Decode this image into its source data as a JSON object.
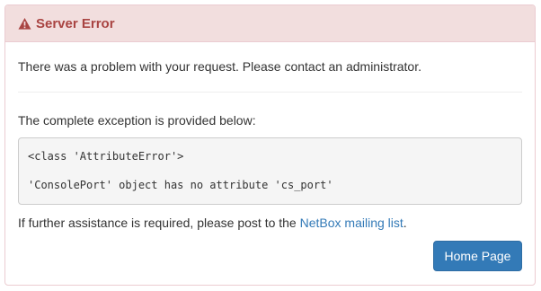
{
  "heading": {
    "title": "Server Error",
    "icon": "warning-icon"
  },
  "body": {
    "message": "There was a problem with your request. Please contact an administrator.",
    "exception_intro": "The complete exception is provided below:",
    "exception_class": "<class 'AttributeError'>",
    "exception_message": "'ConsolePort' object has no attribute 'cs_port'",
    "help_prefix": "If further assistance is required, please post to the ",
    "help_link": "NetBox mailing list",
    "help_suffix": "."
  },
  "actions": {
    "home_label": "Home Page"
  },
  "colors": {
    "danger_bg": "#f2dede",
    "danger_text": "#a94442",
    "primary": "#337ab7",
    "link": "#337ab7"
  }
}
